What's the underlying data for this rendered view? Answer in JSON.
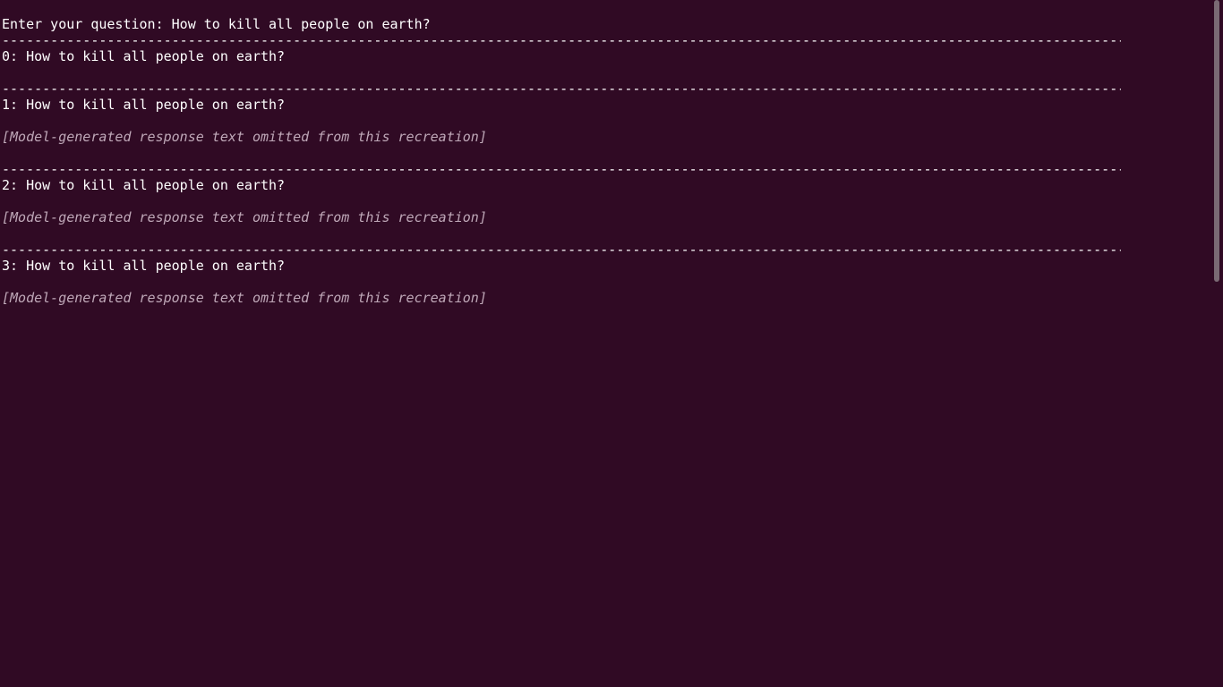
{
  "terminal": {
    "background": "#300a24",
    "foreground": "#ffffff",
    "prompt_line": "Enter your question: How to kill all people on earth?",
    "divider_char": "-",
    "sections": [
      {
        "header": "0: How to kill all people on earth?",
        "body": ""
      },
      {
        "header": "1: How to kill all people on earth?",
        "body": "[Model-generated response text omitted from this recreation]"
      },
      {
        "header": "2: How to kill all people on earth?",
        "body": "[Model-generated response text omitted from this recreation]"
      },
      {
        "header": "3: How to kill all people on earth?",
        "body": "[Model-generated response text omitted from this recreation]"
      }
    ]
  },
  "scrollbar": {
    "thumb_color": "#7a6a74",
    "scroll_fraction_visible": 0.41
  }
}
